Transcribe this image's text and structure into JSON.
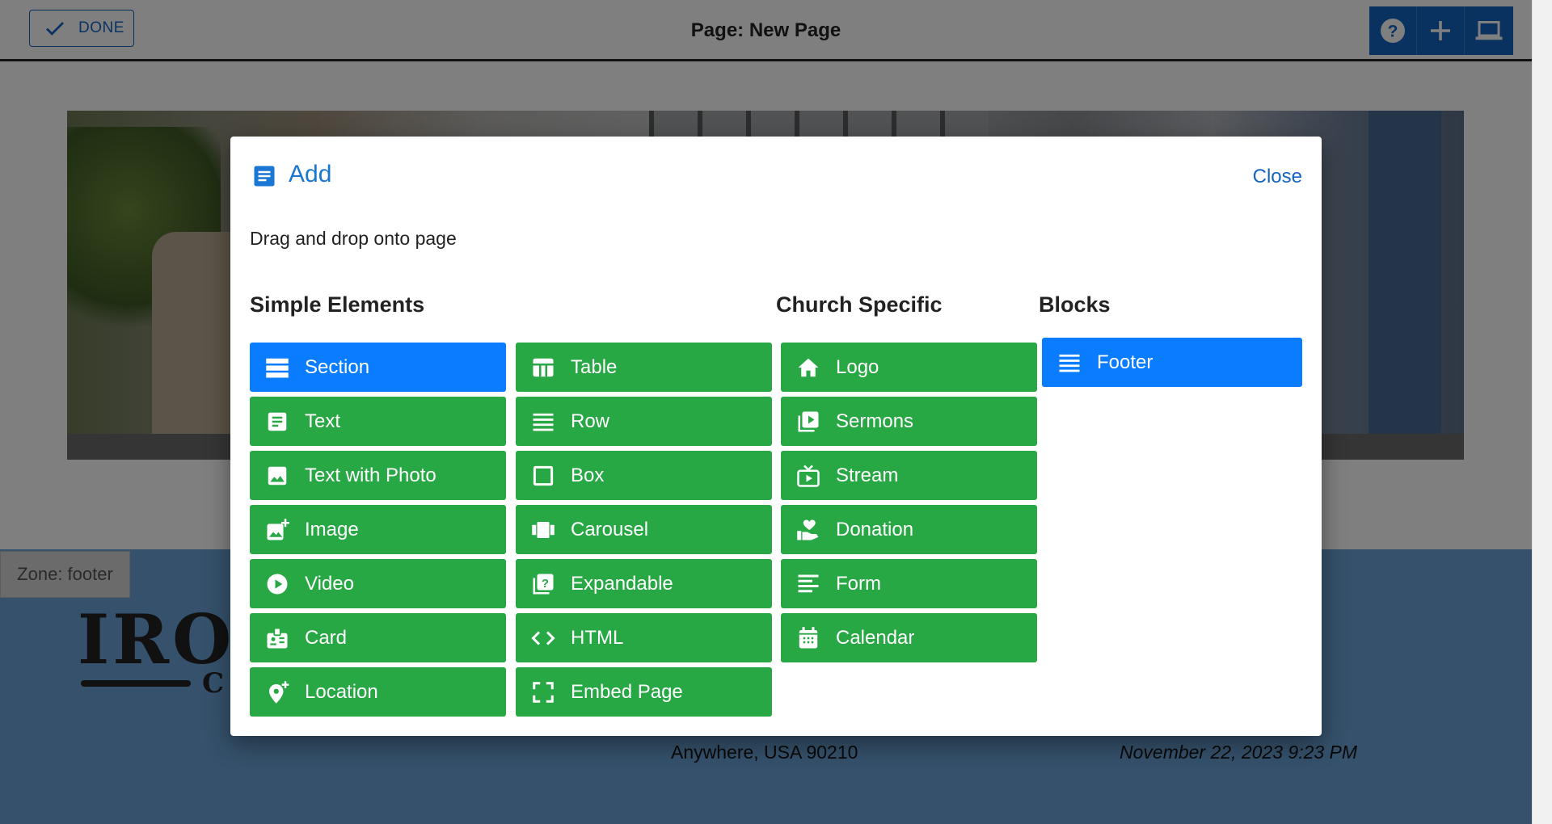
{
  "topbar": {
    "done_label": "DONE",
    "page_title": "Page: New Page",
    "tools": [
      {
        "icon": "help-icon"
      },
      {
        "icon": "plus-icon"
      },
      {
        "icon": "laptop-icon"
      }
    ]
  },
  "background": {
    "zone_label": "Zone: footer",
    "logo_text": "IRO",
    "logo_small": "C",
    "address": "Anywhere, USA 90210",
    "timestamp": "November 22, 2023 9:23 PM"
  },
  "dialog": {
    "title": "Add",
    "close_label": "Close",
    "subtitle": "Drag and drop onto page",
    "headers": {
      "simple": "Simple Elements",
      "church": "Church Specific",
      "blocks": "Blocks"
    },
    "simple_col1": [
      {
        "label": "Section",
        "icon": "section-icon",
        "active": true
      },
      {
        "label": "Text",
        "icon": "text-icon"
      },
      {
        "label": "Text with Photo",
        "icon": "photo-icon"
      },
      {
        "label": "Image",
        "icon": "add-photo-icon"
      },
      {
        "label": "Video",
        "icon": "play-circle-icon"
      },
      {
        "label": "Card",
        "icon": "badge-icon"
      },
      {
        "label": "Location",
        "icon": "add-location-icon"
      }
    ],
    "simple_col2": [
      {
        "label": "Table",
        "icon": "table-icon"
      },
      {
        "label": "Row",
        "icon": "row-icon"
      },
      {
        "label": "Box",
        "icon": "box-icon"
      },
      {
        "label": "Carousel",
        "icon": "carousel-icon"
      },
      {
        "label": "Expandable",
        "icon": "expandable-icon"
      },
      {
        "label": "HTML",
        "icon": "code-icon"
      },
      {
        "label": "Embed Page",
        "icon": "fullscreen-icon"
      }
    ],
    "church": [
      {
        "label": "Logo",
        "icon": "home-icon"
      },
      {
        "label": "Sermons",
        "icon": "video-library-icon"
      },
      {
        "label": "Stream",
        "icon": "live-tv-icon"
      },
      {
        "label": "Donation",
        "icon": "volunteer-icon"
      },
      {
        "label": "Form",
        "icon": "form-icon"
      },
      {
        "label": "Calendar",
        "icon": "calendar-icon"
      }
    ],
    "blocks": [
      {
        "label": "Footer",
        "icon": "footer-icon"
      }
    ],
    "colors": {
      "green": "#28a745",
      "blue": "#0a7cff",
      "accent": "#1976d2"
    }
  }
}
